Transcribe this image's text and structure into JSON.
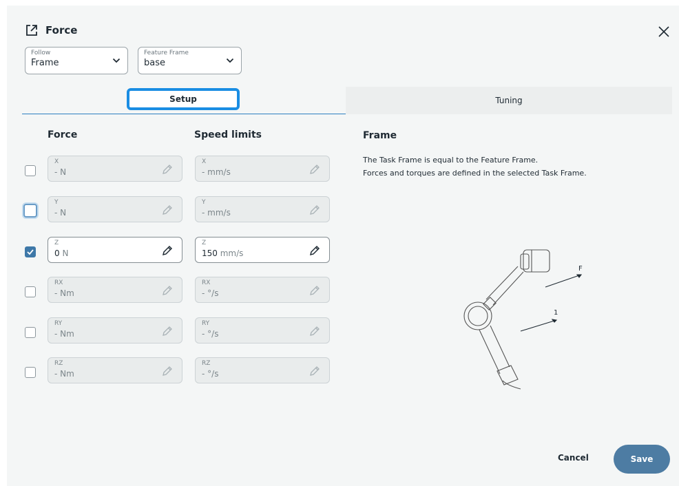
{
  "header": {
    "title": "Force"
  },
  "dropdowns": {
    "follow": {
      "label": "Follow",
      "value": "Frame"
    },
    "feature_frame": {
      "label": "Feature Frame",
      "value": "base"
    }
  },
  "tabs": {
    "setup": "Setup",
    "tuning": "Tuning"
  },
  "columns": {
    "force": "Force",
    "speed": "Speed limits"
  },
  "rows": [
    {
      "checked": false,
      "force": {
        "label": "X",
        "num": "-",
        "unit": " N"
      },
      "speed": {
        "label": "X",
        "num": "-",
        "unit": " mm/s"
      }
    },
    {
      "checked": false,
      "force": {
        "label": "Y",
        "num": "-",
        "unit": " N"
      },
      "speed": {
        "label": "Y",
        "num": "-",
        "unit": " mm/s"
      }
    },
    {
      "checked": true,
      "force": {
        "label": "Z",
        "num": "0",
        "unit": " N"
      },
      "speed": {
        "label": "Z",
        "num": "150",
        "unit": " mm/s"
      }
    },
    {
      "checked": false,
      "force": {
        "label": "RX",
        "num": "-",
        "unit": " Nm"
      },
      "speed": {
        "label": "RX",
        "num": "-",
        "unit": " °/s"
      }
    },
    {
      "checked": false,
      "force": {
        "label": "RY",
        "num": "-",
        "unit": " Nm"
      },
      "speed": {
        "label": "RY",
        "num": "-",
        "unit": " °/s"
      }
    },
    {
      "checked": false,
      "force": {
        "label": "RZ",
        "num": "-",
        "unit": " Nm"
      },
      "speed": {
        "label": "RZ",
        "num": "-",
        "unit": " °/s"
      }
    }
  ],
  "frame": {
    "title": "Frame",
    "line1": "The Task Frame is equal to the Feature Frame.",
    "line2": "Forces and torques are defined in the selected Task Frame.",
    "arrow_f": "F",
    "arrow_1": "1"
  },
  "actions": {
    "cancel": "Cancel",
    "save": "Save"
  },
  "colors": {
    "accent": "#1a8de3",
    "primary": "#4d7ca3",
    "checked": "#3e78a8"
  },
  "icons": [
    "open-in-new-icon",
    "close-icon",
    "chevron-down-icon",
    "pencil-icon",
    "check-icon"
  ]
}
